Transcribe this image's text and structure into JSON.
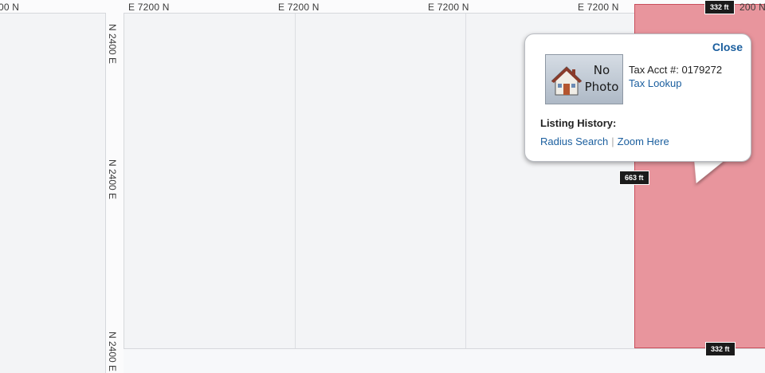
{
  "streets": {
    "top_labels": [
      "00 N",
      "E 7200 N",
      "E 7200 N",
      "E 7200 N",
      "E 7200 N",
      "200 N"
    ],
    "side_labels": [
      "N 2400 E",
      "N 2400 E",
      "N 2400 E"
    ]
  },
  "measurements": {
    "top": "332 ft",
    "side": "663 ft",
    "bottom": "332 ft"
  },
  "popup": {
    "close_label": "Close",
    "photo_text": "No Photo",
    "tax_acct": "Tax Acct #: 0179272",
    "tax_lookup": "Tax Lookup",
    "listing_history": "Listing History:",
    "radius_search": "Radius Search",
    "separator": "|",
    "zoom_here": "Zoom Here"
  },
  "colors": {
    "parcel_fill": "#e8959d",
    "parcel_border": "#c94e5b",
    "link": "#1a5e9e"
  },
  "icons": {
    "house": "house-icon"
  }
}
